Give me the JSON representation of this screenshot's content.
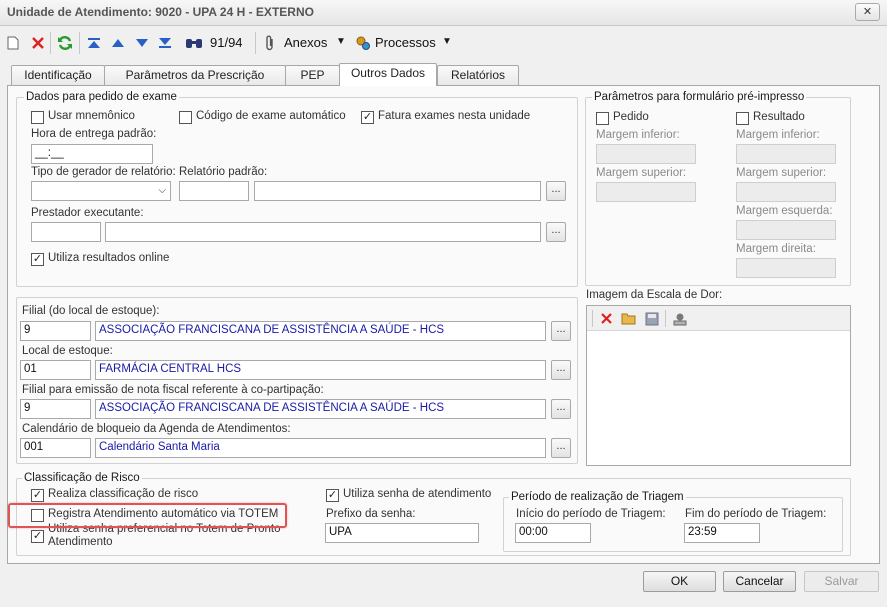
{
  "window": {
    "title": "Unidade de Atendimento: 9020 - UPA 24 H - EXTERNO",
    "close": "✕"
  },
  "toolbar": {
    "record_counter": "91/94",
    "anexos": "Anexos",
    "processos": "Processos"
  },
  "tabs": [
    "Identificação",
    "Parâmetros da Prescrição",
    "PEP",
    "Outros Dados",
    "Relatórios"
  ],
  "exame": {
    "legend": "Dados para pedido de exame",
    "usar_mnemonico": "Usar mnemônico",
    "codigo_automatico": "Código de exame automático",
    "fatura_exames": "Fatura exames nesta unidade",
    "hora_entrega_label": "Hora de entrega padrão:",
    "hora_entrega_value": "__:__",
    "tipo_gerador_label": "Tipo de gerador de relatório:",
    "relatorio_padrao_label": "Relatório padrão:",
    "prestador_label": "Prestador executante:",
    "utiliza_resultados": "Utiliza resultados online",
    "ellipsis": "..."
  },
  "formulario": {
    "legend": "Parâmetros para formulário pré-impresso",
    "pedido": "Pedido",
    "resultado": "Resultado",
    "margem_inferior": "Margem inferior:",
    "margem_superior": "Margem superior:",
    "margem_esquerda": "Margem esquerda:",
    "margem_direita": "Margem direita:"
  },
  "estoque": {
    "filial_label": "Filial (do local de estoque):",
    "filial_code": "9",
    "filial_name": "ASSOCIAÇÃO FRANCISCANA DE ASSISTÊNCIA A SAÚDE - HCS",
    "local_label": "Local de estoque:",
    "local_code": "01",
    "local_name": "FARMÁCIA CENTRAL HCS",
    "filial_nf_label": "Filial para emissão de nota fiscal referente à co-partipação:",
    "filial_nf_code": "9",
    "filial_nf_name": "ASSOCIAÇÃO FRANCISCANA DE ASSISTÊNCIA A SAÚDE - HCS",
    "calendario_label": "Calendário de bloqueio da Agenda de Atendimentos:",
    "calendario_code": "001",
    "calendario_name": "Calendário Santa Maria"
  },
  "imagem": {
    "label": "Imagem da Escala de Dor:"
  },
  "risco": {
    "legend": "Classificação de Risco",
    "realiza": "Realiza classificação de risco",
    "registra_totem": "Registra Atendimento automático via TOTEM",
    "senha_preferencial": "Utiliza senha preferencial no Totem de Pronto Atendimento",
    "utiliza_senha": "Utiliza senha de atendimento",
    "prefixo_label": "Prefixo da senha:",
    "prefixo_value": "UPA"
  },
  "triagem": {
    "legend": "Período de realização de Triagem",
    "inicio_label": "Início do período de Triagem:",
    "inicio_value": "00:00",
    "fim_label": "Fim do período de Triagem:",
    "fim_value": "23:59"
  },
  "buttons": {
    "ok": "OK",
    "cancelar": "Cancelar",
    "salvar": "Salvar"
  },
  "checked_mark": "✓",
  "colors": {
    "highlight": "#e05454",
    "link_text": "#1a1aa6"
  }
}
